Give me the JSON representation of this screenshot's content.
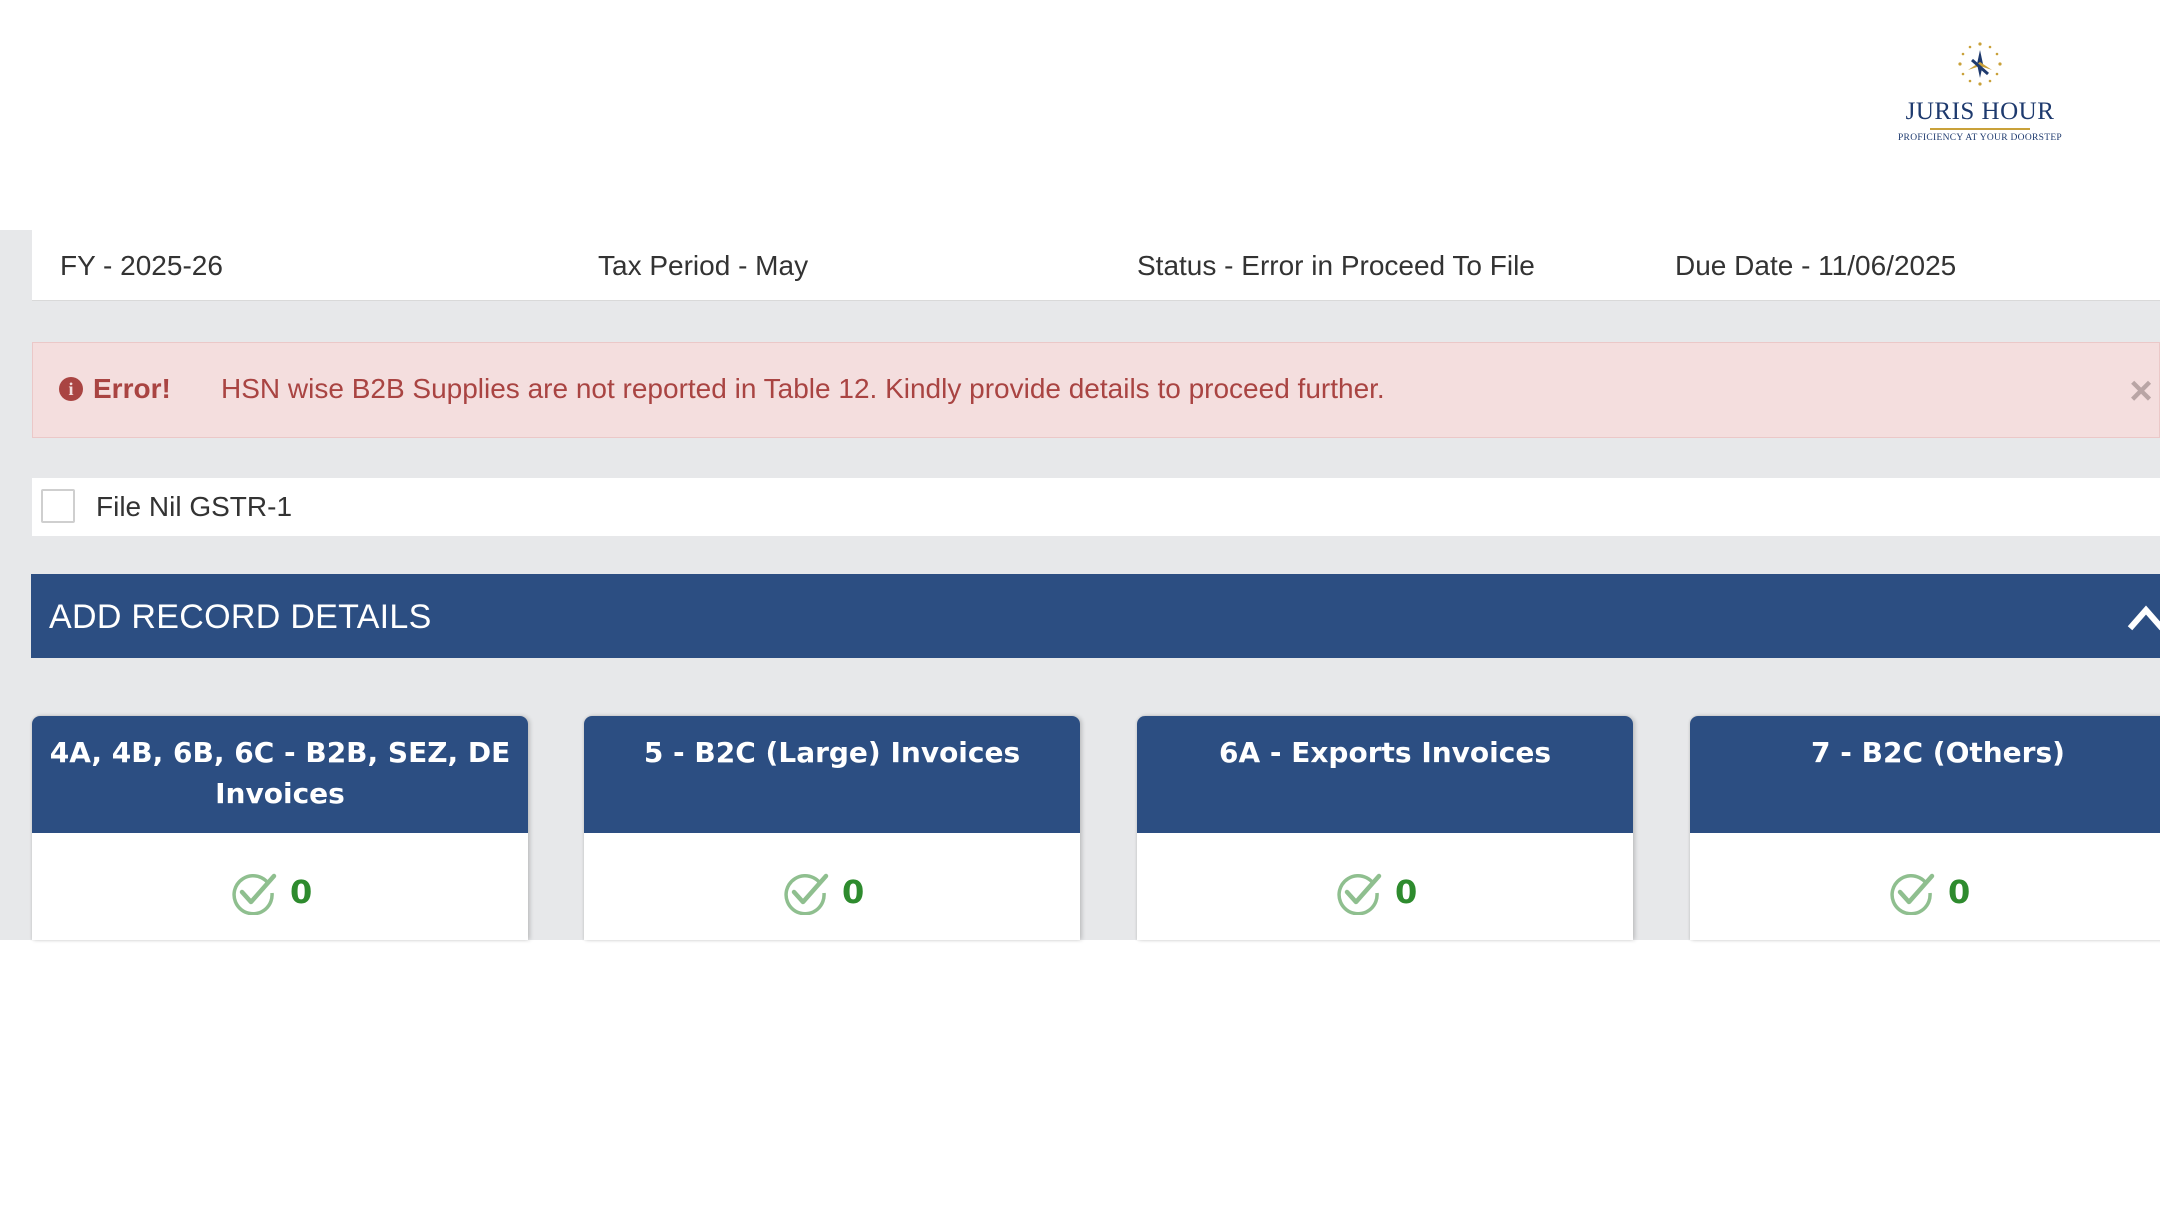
{
  "logo": {
    "name": "JURIS HOUR",
    "tagline": "PROFICIENCY AT YOUR DOORSTEP"
  },
  "info_bar": {
    "fy": "FY - 2025-26",
    "tax_period": "Tax Period - May",
    "status": "Status - Error in Proceed To File",
    "due_date": "Due Date - 11/06/2025"
  },
  "alert": {
    "icon": "info-circle-icon",
    "strong": "Error!",
    "message": "HSN wise B2B Supplies are not reported in Table 12. Kindly provide details to proceed further.",
    "close": "×"
  },
  "nil_filing": {
    "label": "File Nil GSTR-1",
    "checked": false
  },
  "section": {
    "title": "ADD RECORD DETAILS",
    "collapse_icon": "chevron-up-icon"
  },
  "tiles": [
    {
      "title": "4A, 4B, 6B, 6C - B2B, SEZ, DE Invoices",
      "count": "0"
    },
    {
      "title": "5 - B2C (Large) Invoices",
      "count": "0"
    },
    {
      "title": "6A - Exports Invoices",
      "count": "0"
    },
    {
      "title": "7 - B2C (Others)",
      "count": "0"
    }
  ],
  "colors": {
    "header_blue": "#2c4e82",
    "alert_bg": "#f4dede",
    "alert_text": "#a94442",
    "count_green": "#2e8b2e"
  }
}
